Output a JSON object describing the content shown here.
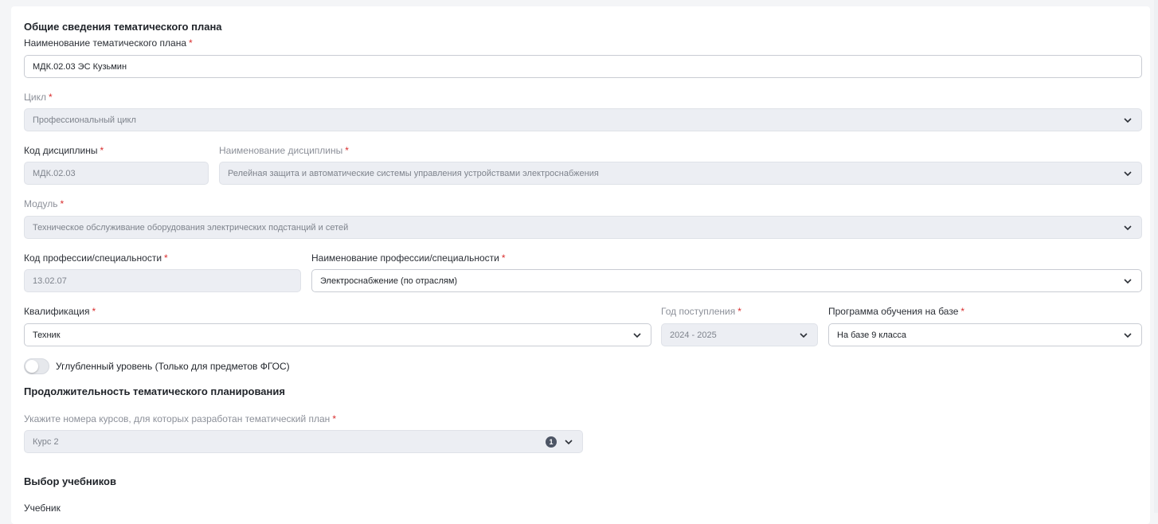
{
  "sections": {
    "general": "Общие сведения тематического плана",
    "duration": "Продолжительность тематического планирования",
    "textbooks": "Выбор учебников"
  },
  "fields": {
    "plan_name": {
      "label": "Наименование тематического плана",
      "value": "МДК.02.03 ЭС Кузьмин"
    },
    "cycle": {
      "label": "Цикл",
      "value": "Профессиональный цикл"
    },
    "discipline_code": {
      "label": "Код дисциплины",
      "value": "МДК.02.03"
    },
    "discipline_name": {
      "label": "Наименование дисциплины",
      "value": "Релейная защита и автоматические системы управления устройствами электроснабжения"
    },
    "module": {
      "label": "Модуль",
      "value": "Техническое обслуживание оборудования электрических подстанций и сетей"
    },
    "profession_code": {
      "label": "Код профессии/специальности",
      "value": "13.02.07"
    },
    "profession_name": {
      "label": "Наименование профессии/специальности",
      "value": "Электроснабжение (по отраслям)"
    },
    "qualification": {
      "label": "Квалификация",
      "value": "Техник"
    },
    "admission_year": {
      "label": "Год поступления",
      "value": "2024 - 2025"
    },
    "program_base": {
      "label": "Программа обучения на базе",
      "value": "На базе 9 класса"
    },
    "courses": {
      "label": "Укажите номера курсов, для которых разработан тематический план",
      "value": "Курс 2",
      "count": "1"
    },
    "textbook": {
      "label": "Учебник"
    }
  },
  "toggle": {
    "label": "Углубленный уровень (Только для предметов ФГОС)",
    "checked": false
  },
  "required_mark": "*",
  "colors": {
    "required": "#d92d2d",
    "disabled_bg": "#eceef3",
    "badge": "#4d5565"
  },
  "icons": {
    "dropdown": "chevron-down-icon"
  }
}
